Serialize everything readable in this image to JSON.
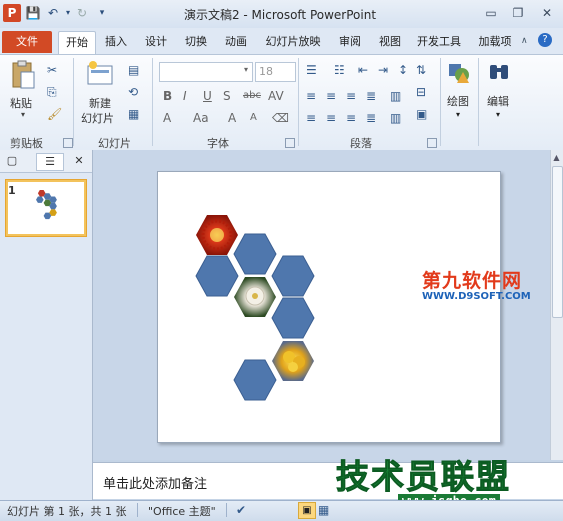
{
  "window": {
    "title": "演示文稿2 - Microsoft PowerPoint",
    "app_logo_letter": "P",
    "controls": [
      "minimize",
      "restore",
      "close"
    ]
  },
  "quick_access": [
    "save",
    "undo",
    "redo",
    "customize"
  ],
  "tabs": {
    "file": "文件",
    "items": [
      "开始",
      "插入",
      "设计",
      "切换",
      "动画",
      "幻灯片放映",
      "审阅",
      "视图",
      "开发工具",
      "加载项"
    ],
    "active": "开始"
  },
  "ribbon": {
    "groups": {
      "clipboard": {
        "label": "剪贴板",
        "paste": "粘贴"
      },
      "slides": {
        "label": "幻灯片",
        "new_slide_line1": "新建",
        "new_slide_line2": "幻灯片"
      },
      "font": {
        "label": "字体",
        "font_size": "18"
      },
      "paragraph": {
        "label": "段落"
      },
      "drawing": {
        "label": "绘图",
        "button": "绘图"
      },
      "editing": {
        "label": "编辑",
        "button": "编辑"
      }
    }
  },
  "slide_panel": {
    "slide_number": "1"
  },
  "slide": {
    "hexagons": [
      {
        "type": "image",
        "image": "red-flower"
      },
      {
        "type": "shape"
      },
      {
        "type": "shape"
      },
      {
        "type": "image",
        "image": "white-flower"
      },
      {
        "type": "shape"
      },
      {
        "type": "shape"
      },
      {
        "type": "image",
        "image": "yellow-flower"
      },
      {
        "type": "shape"
      }
    ],
    "hex_color": "#4f77ad"
  },
  "notes": {
    "placeholder": "单击此处添加备注"
  },
  "status": {
    "slide_info": "幻灯片 第 1 张，共 1 张",
    "theme": "\"Office 主题\""
  },
  "watermarks": {
    "top_title": "第九软件网",
    "top_url": "WWW.D9SOFT.COM",
    "bottom_title": "技术员联盟",
    "bottom_url": "www.jsgho.com"
  },
  "colors": {
    "file_tab": "#d24a25",
    "hexagon": "#4f77ad",
    "thumbnail_border": "#f3c35c"
  }
}
